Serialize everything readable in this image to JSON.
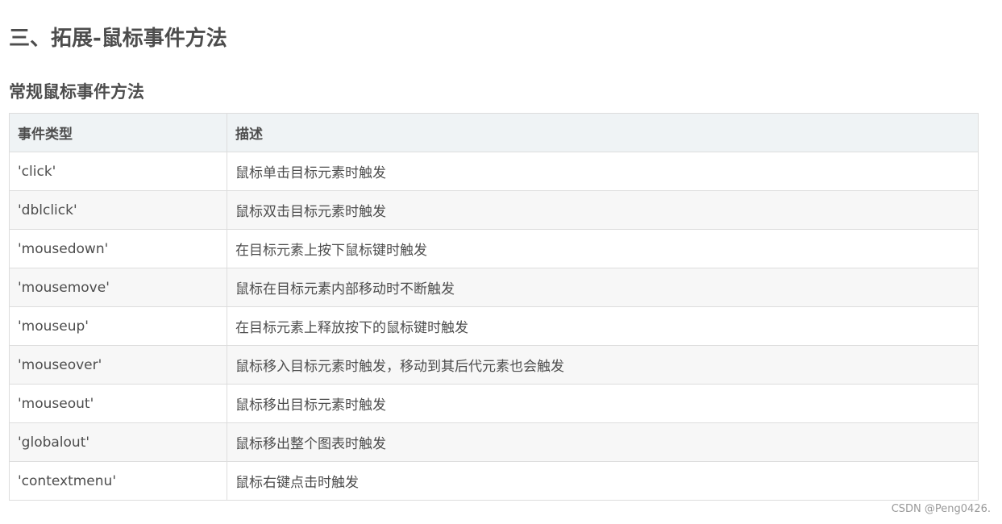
{
  "heading": "三、拓展-鼠标事件方法",
  "subheading": "常规鼠标事件方法",
  "table": {
    "headers": [
      "事件类型",
      "描述"
    ],
    "rows": [
      [
        "'click'",
        "鼠标单击目标元素时触发"
      ],
      [
        "'dblclick'",
        "鼠标双击目标元素时触发"
      ],
      [
        "'mousedown'",
        "在目标元素上按下鼠标键时触发"
      ],
      [
        "'mousemove'",
        "鼠标在目标元素内部移动时不断触发"
      ],
      [
        "'mouseup'",
        "在目标元素上释放按下的鼠标键时触发"
      ],
      [
        "'mouseover'",
        "鼠标移入目标元素时触发，移动到其后代元素也会触发"
      ],
      [
        "'mouseout'",
        "鼠标移出目标元素时触发"
      ],
      [
        "'globalout'",
        "鼠标移出整个图表时触发"
      ],
      [
        "'contextmenu'",
        "鼠标右键点击时触发"
      ]
    ]
  },
  "watermark": "CSDN @Peng0426."
}
